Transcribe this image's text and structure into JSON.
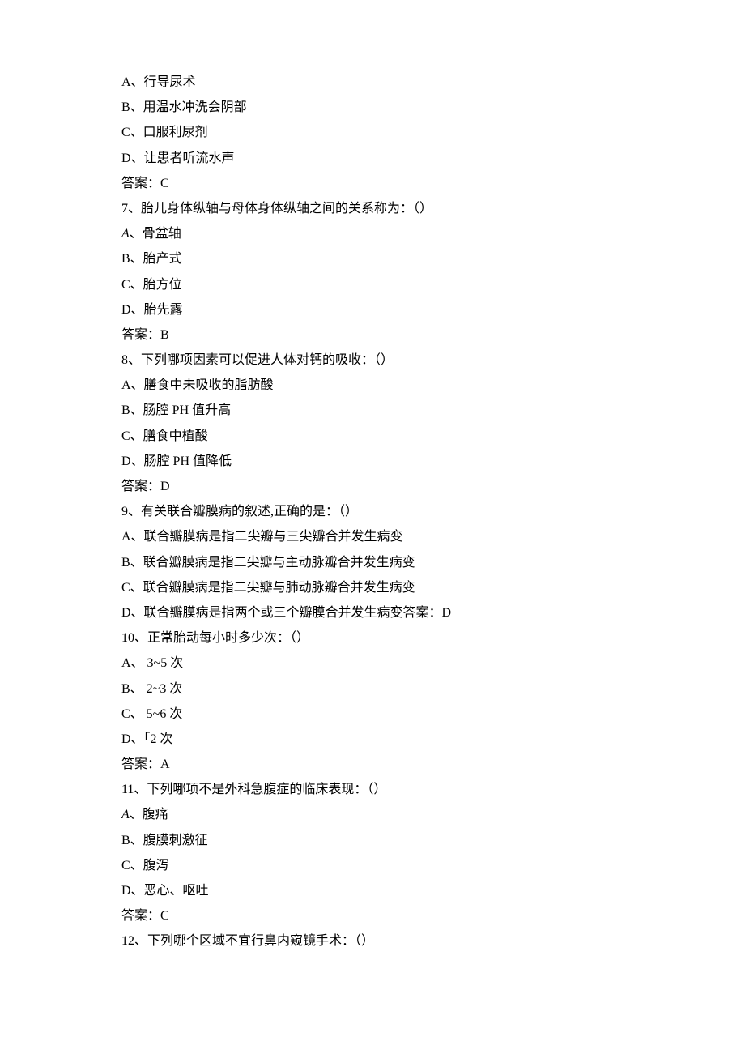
{
  "lines": [
    {
      "text": "A、行导尿术"
    },
    {
      "text": "B、用温水冲洗会阴部"
    },
    {
      "text": "C、口服利尿剂"
    },
    {
      "text": "D、让患者听流水声"
    },
    {
      "text": "答案：C"
    },
    {
      "text": "7、胎儿身体纵轴与母体身体纵轴之间的关系称为：（）"
    },
    {
      "text": "A、骨盆轴",
      "italic": "A"
    },
    {
      "text": "B、胎产式"
    },
    {
      "text": "C、胎方位"
    },
    {
      "text": "D、胎先露"
    },
    {
      "text": "答案：B"
    },
    {
      "text": "8、下列哪项因素可以促进人体对钙的吸收：（）"
    },
    {
      "text": "A、膳食中未吸收的脂肪酸"
    },
    {
      "text": "B、肠腔 PH 值升高"
    },
    {
      "text": "C、膳食中植酸"
    },
    {
      "text": "D、肠腔 PH 值降低"
    },
    {
      "text": "答案：D"
    },
    {
      "text": "9、有关联合瓣膜病的叙述,正确的是：（）"
    },
    {
      "text": "A、联合瓣膜病是指二尖瓣与三尖瓣合并发生病变"
    },
    {
      "text": "B、联合瓣膜病是指二尖瓣与主动脉瓣合并发生病变"
    },
    {
      "text": "C、联合瓣膜病是指二尖瓣与肺动脉瓣合并发生病变"
    },
    {
      "text": "D、联合瓣膜病是指两个或三个瓣膜合并发生病变答案：D"
    },
    {
      "text": "10、正常胎动每小时多少次：（）"
    },
    {
      "text": "A、 3~5 次"
    },
    {
      "text": "B、 2~3 次"
    },
    {
      "text": "C、 5~6 次"
    },
    {
      "text": "D、「2 次"
    },
    {
      "text": "答案：A"
    },
    {
      "text": "11、下列哪项不是外科急腹症的临床表现：（）"
    },
    {
      "text": "A、腹痛",
      "italic": "A"
    },
    {
      "text": "B、腹膜刺激征"
    },
    {
      "text": "C、腹泻"
    },
    {
      "text": "D、恶心、呕吐"
    },
    {
      "text": "答案：C"
    },
    {
      "text": "12、下列哪个区域不宜行鼻内窥镜手术：（）"
    }
  ]
}
